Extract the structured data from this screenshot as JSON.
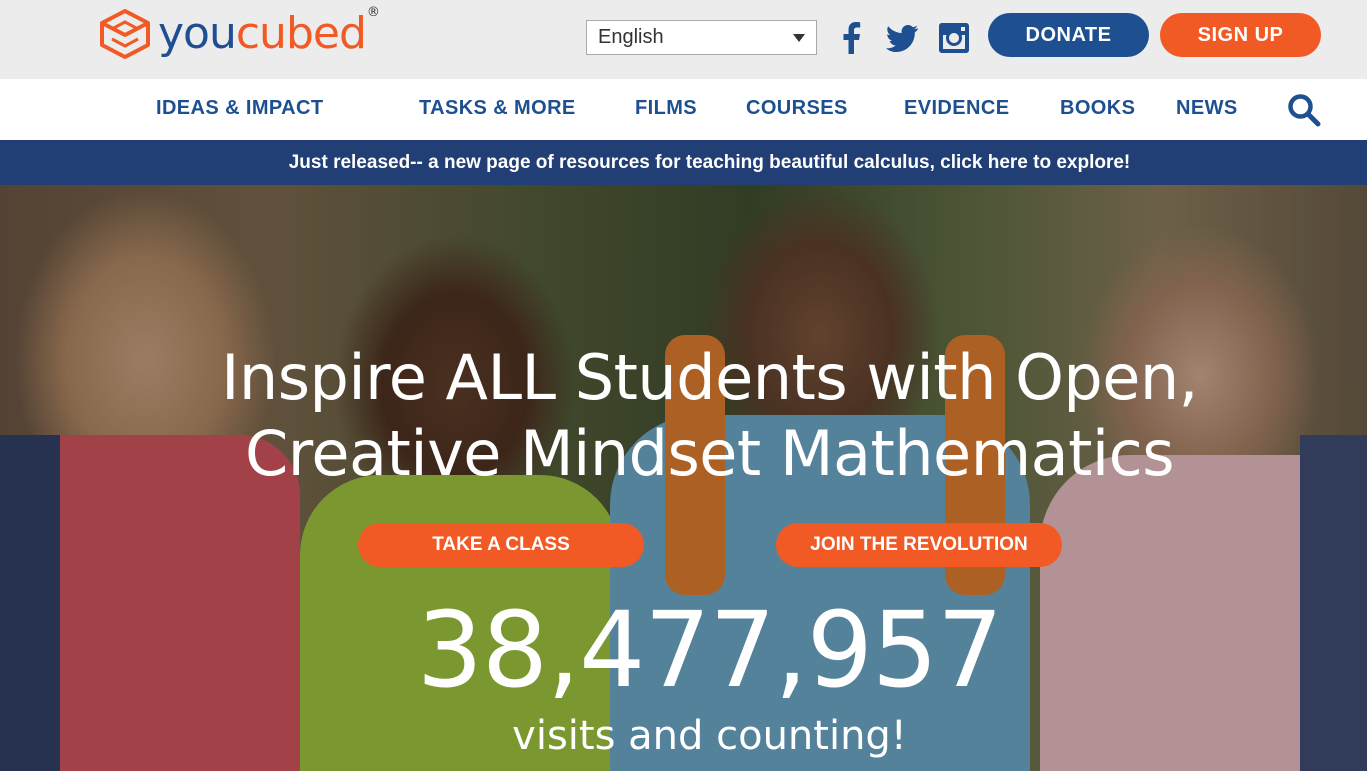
{
  "brand": {
    "name_part1": "you",
    "name_part2": "cubed",
    "registered": "®",
    "blue": "#1d4f91",
    "orange": "#f15a24"
  },
  "header": {
    "language_selected": "English",
    "social_icons": [
      "facebook-icon",
      "twitter-icon",
      "instagram-icon"
    ],
    "donate_label": "DONATE",
    "signup_label": "SIGN UP"
  },
  "nav": {
    "items": [
      {
        "label": "IDEAS & IMPACT"
      },
      {
        "label": "TASKS & MORE"
      },
      {
        "label": "FILMS"
      },
      {
        "label": "COURSES"
      },
      {
        "label": "EVIDENCE"
      },
      {
        "label": "BOOKS"
      },
      {
        "label": "NEWS"
      }
    ],
    "search_icon": "search-icon"
  },
  "announcement": {
    "text": "Just released-- a new page of resources for teaching beautiful calculus, click here to explore!",
    "background": "#213f75"
  },
  "hero": {
    "headline_line1": "Inspire ALL Students with Open,",
    "headline_line2": "Creative Mindset Mathematics",
    "cta_primary": "TAKE A CLASS",
    "cta_secondary": "JOIN THE REVOLUTION",
    "visit_count": "38,477,957",
    "visit_caption": "visits and counting!"
  }
}
